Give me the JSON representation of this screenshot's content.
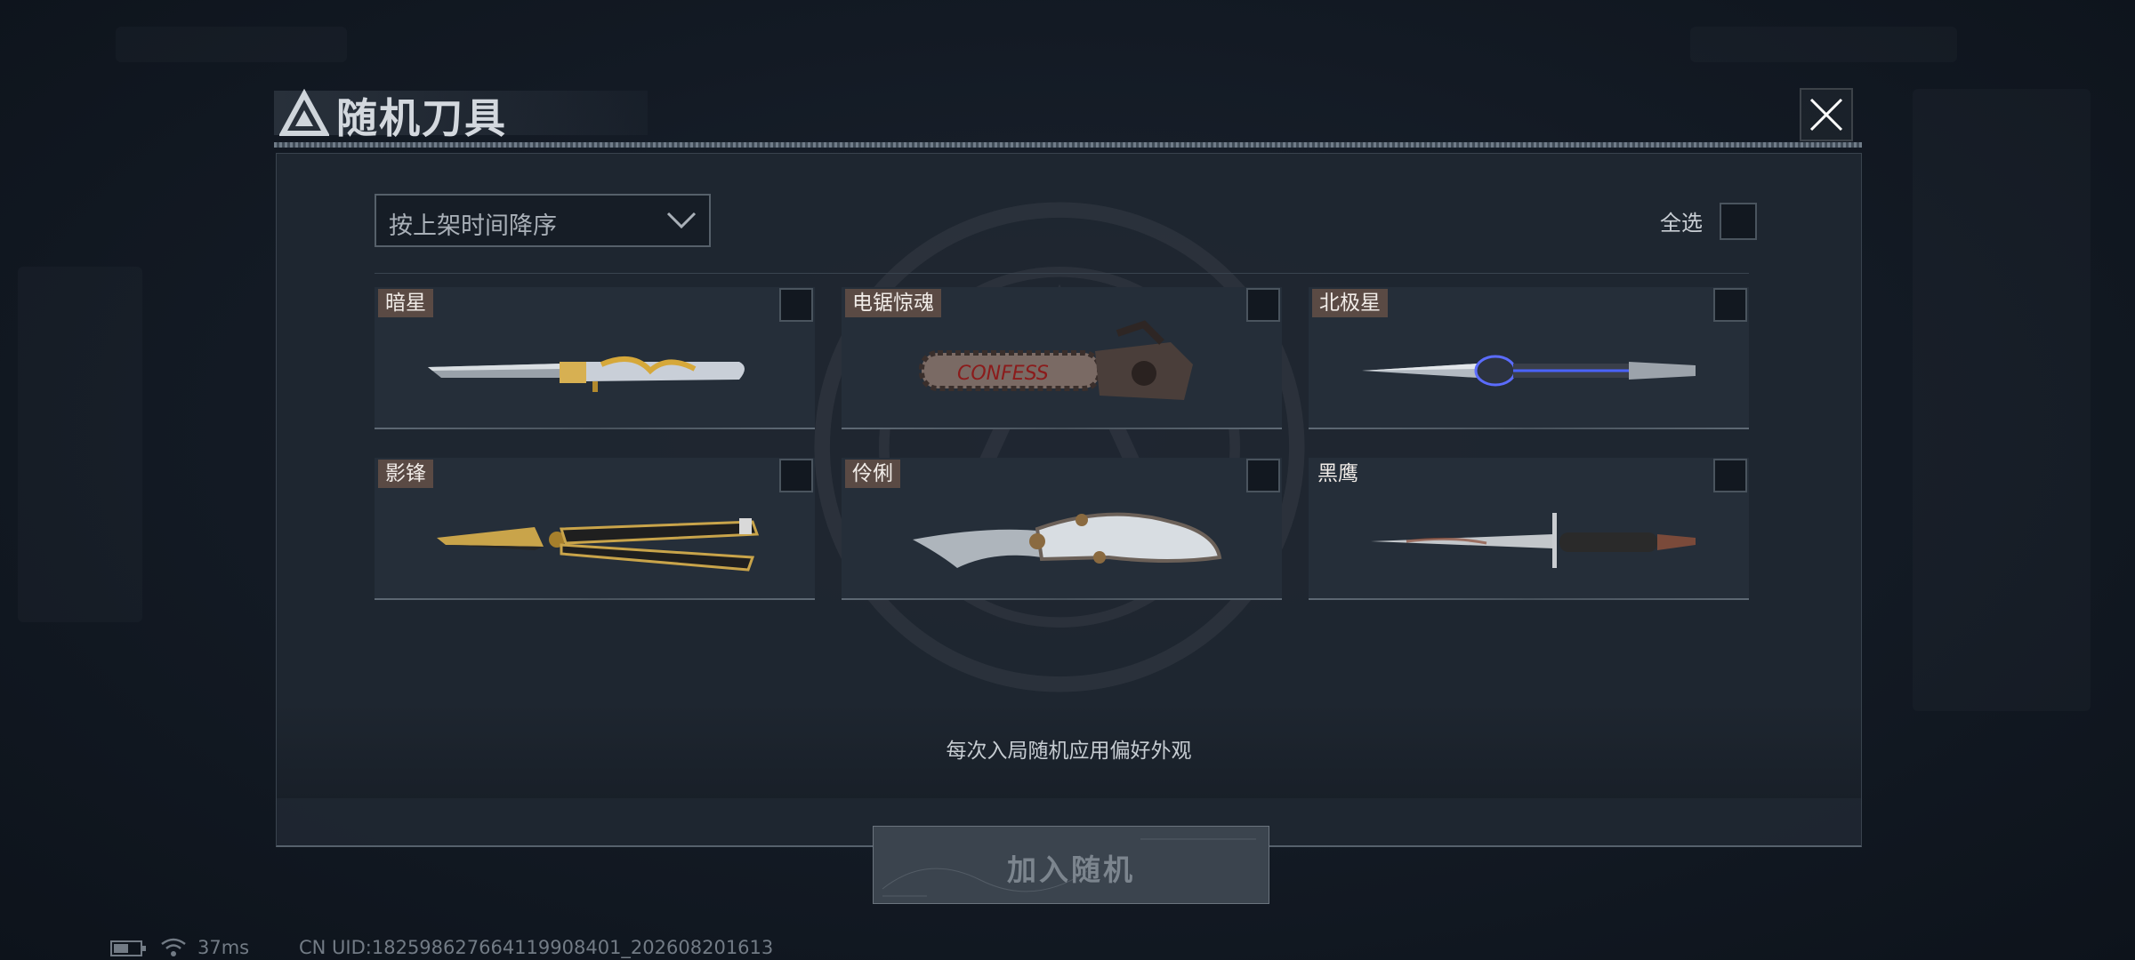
{
  "dialog": {
    "title": "随机刀具",
    "close_icon": "close-icon"
  },
  "sort": {
    "selected": "按上架时间降序"
  },
  "select_all": {
    "label": "全选"
  },
  "knives": [
    {
      "name": "暗星",
      "icon": "knife-dagger-gold-icon"
    },
    {
      "name": "电锯惊魂",
      "icon": "chainsaw-icon"
    },
    {
      "name": "北极星",
      "icon": "knife-blue-crystal-icon"
    },
    {
      "name": "影锋",
      "icon": "butterfly-knife-icon"
    },
    {
      "name": "伶俐",
      "icon": "karambit-knife-icon"
    },
    {
      "name": "黑鹰",
      "icon": "combat-knife-icon"
    }
  ],
  "hint": "每次入局随机应用偏好外观",
  "add_button": {
    "label": "加入随机"
  },
  "status": {
    "ping": "37ms",
    "uid": "CN UID:182598627664119908401_202608201613"
  },
  "colors": {
    "accent_label": "#5a4a44",
    "panel": "#1f2731"
  }
}
